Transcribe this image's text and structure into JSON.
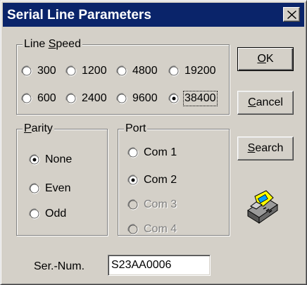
{
  "dialog": {
    "title": "Serial Line Parameters",
    "close_label": "×"
  },
  "line_speed": {
    "legend": "Line Speed",
    "legend_accel": "S",
    "selected": "38400",
    "options": [
      "300",
      "1200",
      "4800",
      "19200",
      "600",
      "2400",
      "9600",
      "38400"
    ]
  },
  "parity": {
    "legend": "Parity",
    "legend_accel": "P",
    "selected": "None",
    "options": [
      "None",
      "Even",
      "Odd"
    ]
  },
  "port": {
    "legend": "Port",
    "selected": "Com 2",
    "options": [
      {
        "label": "Com 1",
        "enabled": true
      },
      {
        "label": "Com 2",
        "enabled": true
      },
      {
        "label": "Com 3",
        "enabled": false
      },
      {
        "label": "Com 4",
        "enabled": false
      }
    ]
  },
  "buttons": {
    "ok": "OK",
    "cancel": "Cancel",
    "search": "Search"
  },
  "serial": {
    "label": "Ser.-Num.",
    "value": "S23AA0006"
  },
  "icons": {
    "close": "close-icon",
    "device": "telephone-modem-icon"
  }
}
